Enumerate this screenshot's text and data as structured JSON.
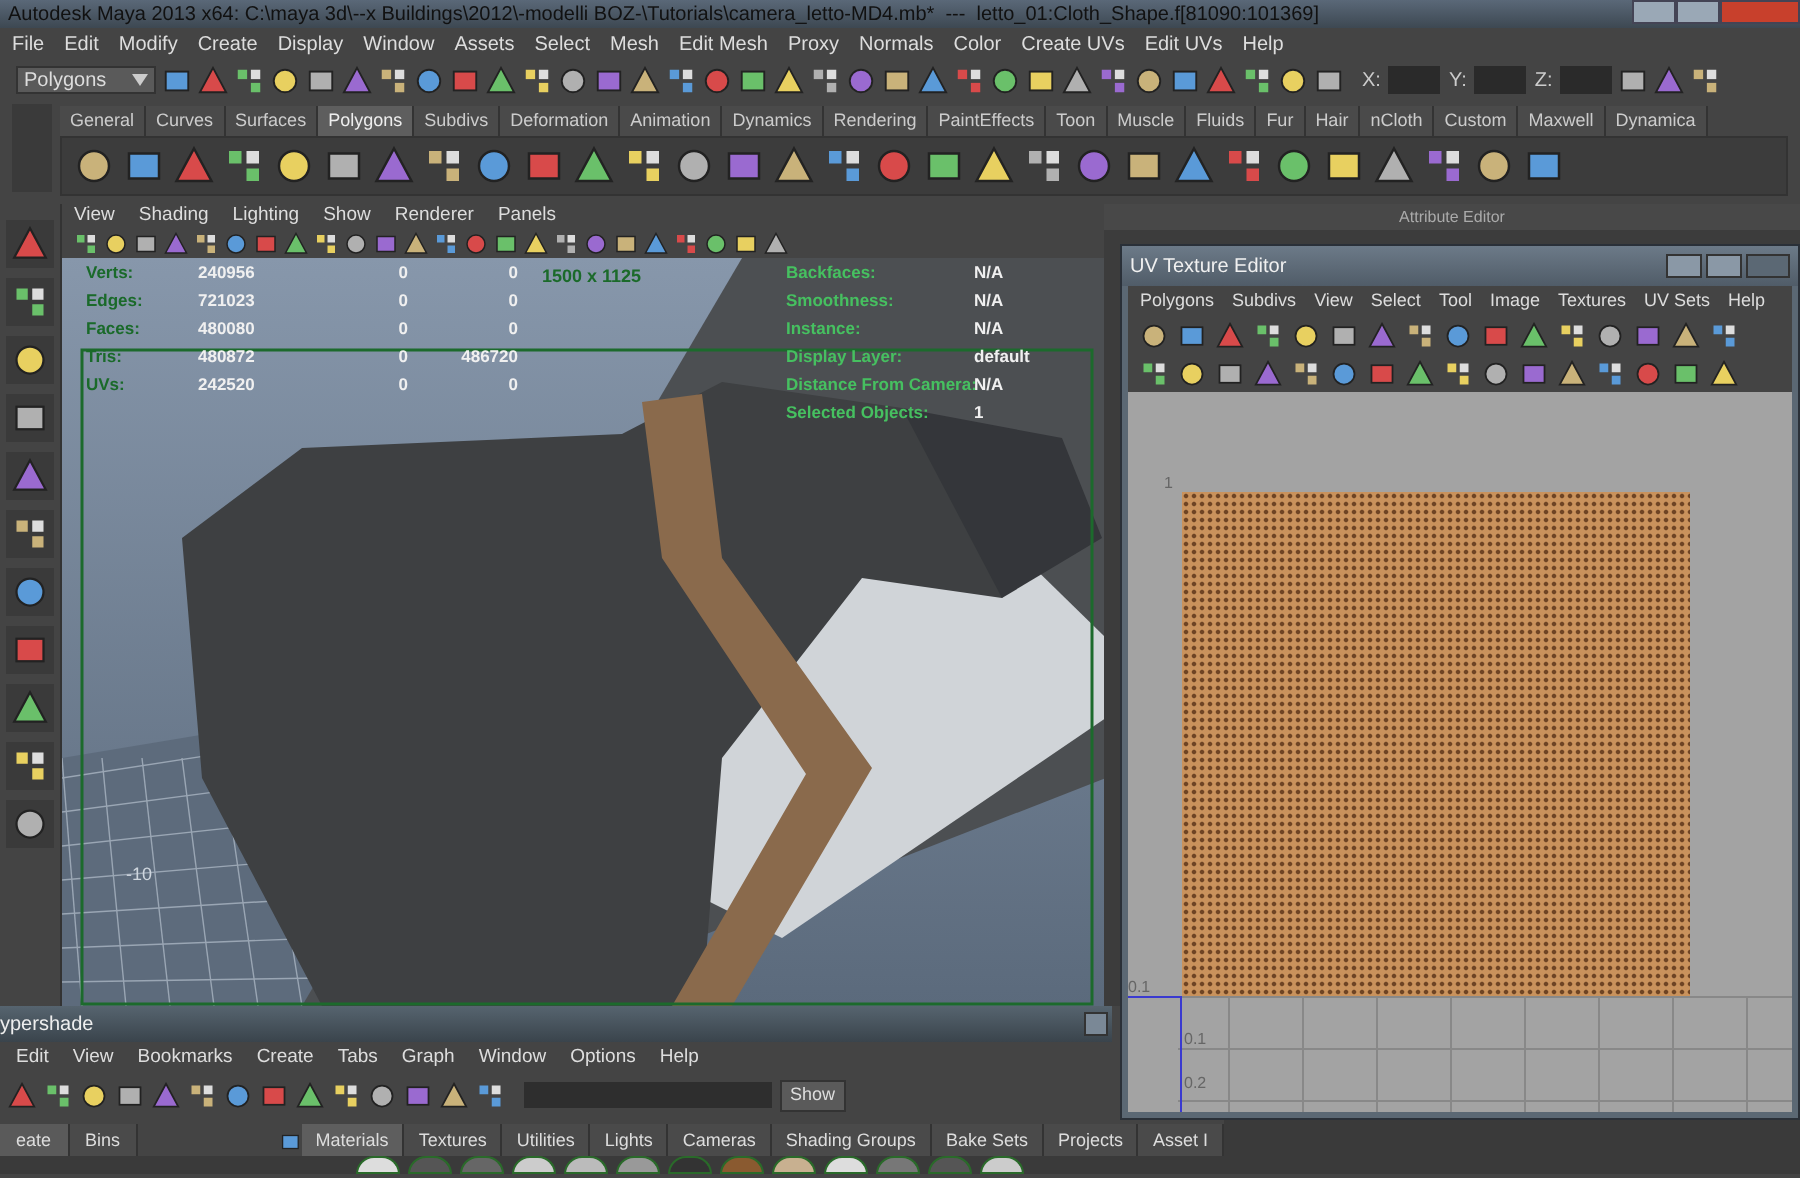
{
  "window": {
    "title": "Autodesk Maya 2013 x64: C:\\maya 3d\\--x Buildings\\2012\\-modelli BOZ-\\Tutorials\\camera_letto-MD4.mb*  ---  letto_01:Cloth_Shape.f[81090:101369]"
  },
  "main_menu": [
    "File",
    "Edit",
    "Modify",
    "Create",
    "Display",
    "Window",
    "Assets",
    "Select",
    "Mesh",
    "Edit Mesh",
    "Proxy",
    "Normals",
    "Color",
    "Create UVs",
    "Edit UVs",
    "Help"
  ],
  "toolbar": {
    "mode_menu": "Polygons",
    "coordinate_fields": [
      {
        "label": "X:"
      },
      {
        "label": "Y:"
      },
      {
        "label": "Z:"
      }
    ]
  },
  "shelf": {
    "tabs": [
      {
        "label": "General",
        "selected": false
      },
      {
        "label": "Curves",
        "selected": false
      },
      {
        "label": "Surfaces",
        "selected": false
      },
      {
        "label": "Polygons",
        "selected": true
      },
      {
        "label": "Subdivs",
        "selected": false
      },
      {
        "label": "Deformation",
        "selected": false
      },
      {
        "label": "Animation",
        "selected": false
      },
      {
        "label": "Dynamics",
        "selected": false
      },
      {
        "label": "Rendering",
        "selected": false
      },
      {
        "label": "PaintEffects",
        "selected": false
      },
      {
        "label": "Toon",
        "selected": false
      },
      {
        "label": "Muscle",
        "selected": false
      },
      {
        "label": "Fluids",
        "selected": false
      },
      {
        "label": "Fur",
        "selected": false
      },
      {
        "label": "Hair",
        "selected": false
      },
      {
        "label": "nCloth",
        "selected": false
      },
      {
        "label": "Custom",
        "selected": false
      },
      {
        "label": "Maxwell",
        "selected": false
      },
      {
        "label": "Dynamica",
        "selected": false
      }
    ]
  },
  "viewport": {
    "menu": [
      "View",
      "Shading",
      "Lighting",
      "Show",
      "Renderer",
      "Panels"
    ],
    "resolution": "1500 x 1125",
    "grid_label": "-10",
    "stats": [
      {
        "label": "Verts:",
        "values": [
          "240956",
          "0",
          "0"
        ]
      },
      {
        "label": "Edges:",
        "values": [
          "721023",
          "0",
          "0"
        ]
      },
      {
        "label": "Faces:",
        "values": [
          "480080",
          "0",
          "0"
        ]
      },
      {
        "label": "Tris:",
        "values": [
          "480872",
          "0",
          "486720"
        ]
      },
      {
        "label": "UVs:",
        "values": [
          "242520",
          "0",
          "0"
        ]
      }
    ],
    "info": [
      {
        "label": "Backfaces:",
        "value": "N/A"
      },
      {
        "label": "Smoothness:",
        "value": "N/A"
      },
      {
        "label": "Instance:",
        "value": "N/A"
      },
      {
        "label": "Display Layer:",
        "value": "default"
      },
      {
        "label": "Distance From Camera:",
        "value": "N/A"
      },
      {
        "label": "Selected Objects:",
        "value": "1"
      }
    ]
  },
  "attribute_editor": {
    "title": "Attribute Editor"
  },
  "uv_editor": {
    "title": "UV Texture Editor",
    "menu": [
      "Polygons",
      "Subdivs",
      "View",
      "Select",
      "Tool",
      "Image",
      "Textures",
      "UV Sets",
      "Help"
    ],
    "axis_labels": [
      "1",
      "0.1",
      "0.1",
      "0.2"
    ]
  },
  "hypershade": {
    "title": "ypershade",
    "menu": [
      "Edit",
      "View",
      "Bookmarks",
      "Create",
      "Tabs",
      "Graph",
      "Window",
      "Options",
      "Help"
    ],
    "show_button": "Show",
    "left_tabs": [
      {
        "label": "eate",
        "selected": true
      },
      {
        "label": "Bins",
        "selected": false
      }
    ],
    "tabs": [
      {
        "label": "Materials",
        "selected": true
      },
      {
        "label": "Textures",
        "selected": false
      },
      {
        "label": "Utilities",
        "selected": false
      },
      {
        "label": "Lights",
        "selected": false
      },
      {
        "label": "Cameras",
        "selected": false
      },
      {
        "label": "Shading Groups",
        "selected": false
      },
      {
        "label": "Bake Sets",
        "selected": false
      },
      {
        "label": "Projects",
        "selected": false
      },
      {
        "label": "Asset I",
        "selected": false
      }
    ]
  }
}
